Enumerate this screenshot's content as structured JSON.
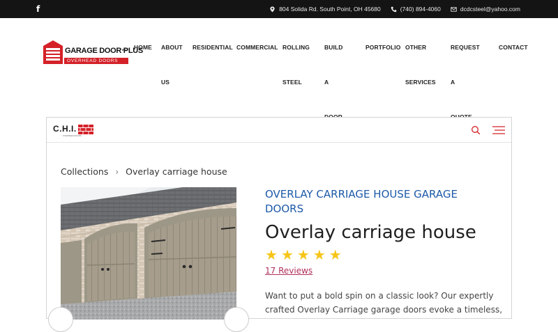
{
  "topbar": {
    "facebook_glyph": "f",
    "address": "804 Solida Rd. South Point, OH 45680",
    "phone": "(740) 894-4060",
    "email": "dcdcsteel@yahoo.com",
    "icons": [
      "facebook-icon",
      "location-pin-icon",
      "phone-icon",
      "envelope-icon"
    ]
  },
  "logo": {
    "name": "GARAGE DOOR PLUS",
    "suffix": "INC",
    "tagline": "OVERHEAD DOORS"
  },
  "nav": {
    "items": [
      {
        "line1": "HOME",
        "line2": ""
      },
      {
        "line1": "ABOUT",
        "line2": "US"
      },
      {
        "line1": "RESIDENTIAL",
        "line2": ""
      },
      {
        "line1": "COMMERCIAL",
        "line2": ""
      },
      {
        "line1": "ROLLING",
        "line2": "STEEL"
      },
      {
        "line1": "BUILD A",
        "line2": "DOOR"
      },
      {
        "line1": "PORTFOLIO",
        "line2": ""
      },
      {
        "line1": "OTHER",
        "line2": "SERVICES"
      },
      {
        "line1": "REQUEST A",
        "line2": "QUOTE"
      },
      {
        "line1": "CONTACT",
        "line2": ""
      }
    ]
  },
  "embed": {
    "brand": "C.H.I.",
    "brand_sub": "OVERHEAD DOORS",
    "breadcrumb": {
      "root": "Collections",
      "separator": "›",
      "current": "Overlay carriage house"
    },
    "category_title": "OVERLAY CARRIAGE HOUSE GARAGE DOORS",
    "product_title": "Overlay carriage house",
    "rating": 5,
    "stars": [
      "★",
      "★",
      "★",
      "★",
      "★"
    ],
    "reviews_link": "17 Reviews",
    "description": "Want to put a bold spin on a classic look? Our expertly crafted Overlay Carriage garage doors evoke a timeless,"
  },
  "colors": {
    "topbar_bg": "#141414",
    "brand_red": "#d42128",
    "category_blue": "#1c5aa8",
    "star_gold": "#f5c518",
    "review_link": "#b0305a"
  }
}
